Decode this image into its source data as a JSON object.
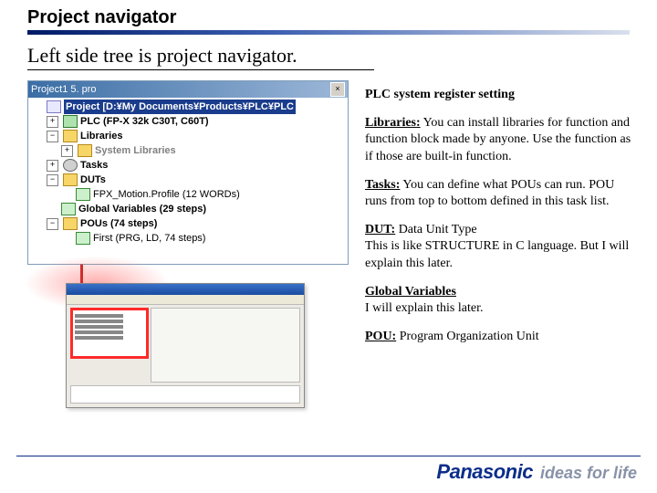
{
  "header": {
    "title": "Project navigator",
    "subtitle": "Left side tree is project navigator."
  },
  "tree": {
    "window_title": "Project1 5. pro",
    "close_glyph": "×",
    "nodes": {
      "project": {
        "exp": "",
        "label": "Project [D:¥My Documents¥Products¥PLC¥PLC"
      },
      "plc": {
        "exp": "+",
        "label": "PLC (FP-X 32k C30T, C60T)"
      },
      "libraries": {
        "exp": "−",
        "label": "Libraries"
      },
      "syslibs": {
        "exp": "+",
        "label": "System Libraries"
      },
      "tasks": {
        "exp": "+",
        "label": "Tasks"
      },
      "duts": {
        "exp": "−",
        "label": "DUTs"
      },
      "motion": {
        "exp": "",
        "label": "FPX_Motion.Profile (12 WORDs)"
      },
      "globals": {
        "exp": "",
        "label": "Global Variables (29 steps)"
      },
      "pous": {
        "exp": "−",
        "label": "POUs (74 steps)"
      },
      "first": {
        "exp": "",
        "label": "First (PRG, LD, 74 steps)"
      }
    }
  },
  "right": {
    "plc_reg": "PLC system register setting",
    "libs_h": "Libraries:",
    "libs_b": " You can install libraries for function and function block made by anyone.  Use the function as if those are built-in function.",
    "tasks_h": "Tasks:",
    "tasks_b": " You can define what POUs can run.  POU runs from top to bottom defined in this task list.",
    "dut_h": "DUT:",
    "dut_b": " Data Unit Type\nThis is like STRUCTURE in C language.  But I will explain this later.",
    "gv_h": "Global Variables",
    "gv_b": "I will explain this later.",
    "pou_h": "POU:",
    "pou_b": " Program Organization Unit"
  },
  "brand": {
    "name": "Panasonic",
    "tagline": "ideas for life"
  }
}
